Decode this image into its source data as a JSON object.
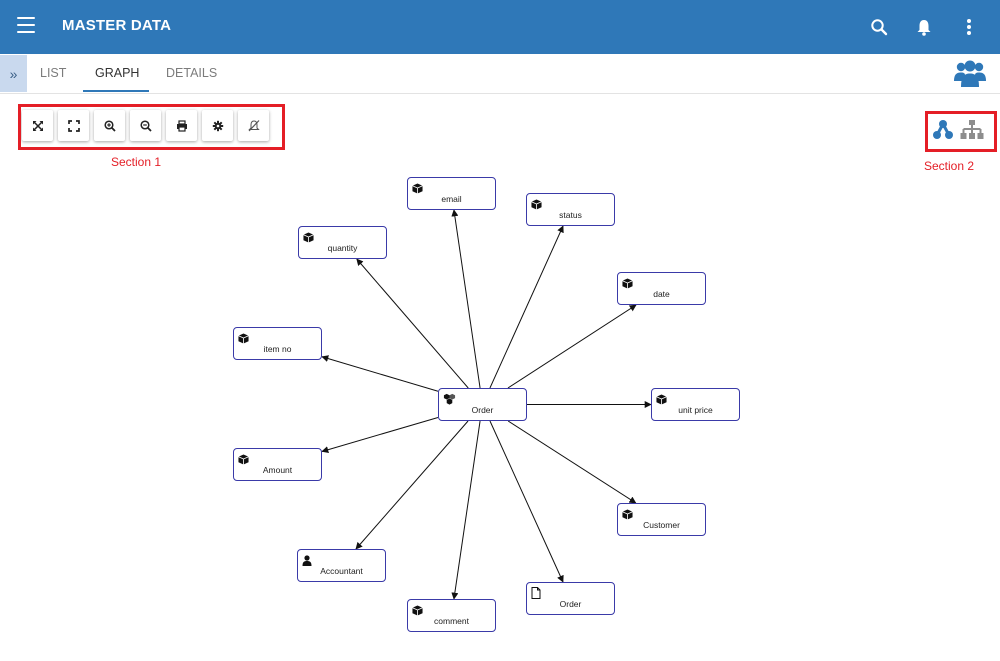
{
  "app": {
    "title": "MASTER DATA"
  },
  "header_actions": [
    {
      "name": "search-icon"
    },
    {
      "name": "bell-icon"
    },
    {
      "name": "more-vert-icon"
    }
  ],
  "tabs": [
    {
      "label": "LIST",
      "active": false
    },
    {
      "label": "GRAPH",
      "active": true
    },
    {
      "label": "DETAILS",
      "active": false
    }
  ],
  "expander": {
    "glyph": "»"
  },
  "toolbar": [
    {
      "name": "fit-graph-icon"
    },
    {
      "name": "fullscreen-icon"
    },
    {
      "name": "zoom-in-icon"
    },
    {
      "name": "zoom-out-icon"
    },
    {
      "name": "print-icon"
    },
    {
      "name": "settings-icon"
    },
    {
      "name": "disable-icon"
    }
  ],
  "annotations": {
    "section1": "Section 1",
    "section2": "Section 2"
  },
  "layout_buttons": [
    {
      "name": "network-layout-icon",
      "color": "#2f78b8"
    },
    {
      "name": "hierarchy-layout-icon",
      "color": "#8d8d8d"
    }
  ],
  "colors": {
    "brand": "#2f78b8",
    "highlight": "#e41e26",
    "node_border": "#3a3aa8"
  },
  "graph": {
    "center": {
      "id": "order-center",
      "label": "Order",
      "icon": "entity-group"
    },
    "nodes": [
      {
        "id": "email",
        "label": "email",
        "icon": "cube"
      },
      {
        "id": "status",
        "label": "status",
        "icon": "cube"
      },
      {
        "id": "quantity",
        "label": "quantity",
        "icon": "cube"
      },
      {
        "id": "date",
        "label": "date",
        "icon": "cube"
      },
      {
        "id": "item-no",
        "label": "item no",
        "icon": "cube"
      },
      {
        "id": "unit-price",
        "label": "unit price",
        "icon": "cube"
      },
      {
        "id": "amount",
        "label": "Amount",
        "icon": "cube"
      },
      {
        "id": "customer",
        "label": "Customer",
        "icon": "cube"
      },
      {
        "id": "accountant",
        "label": "Accountant",
        "icon": "person"
      },
      {
        "id": "order-doc",
        "label": "Order",
        "icon": "document"
      },
      {
        "id": "comment",
        "label": "comment",
        "icon": "cube"
      }
    ]
  }
}
